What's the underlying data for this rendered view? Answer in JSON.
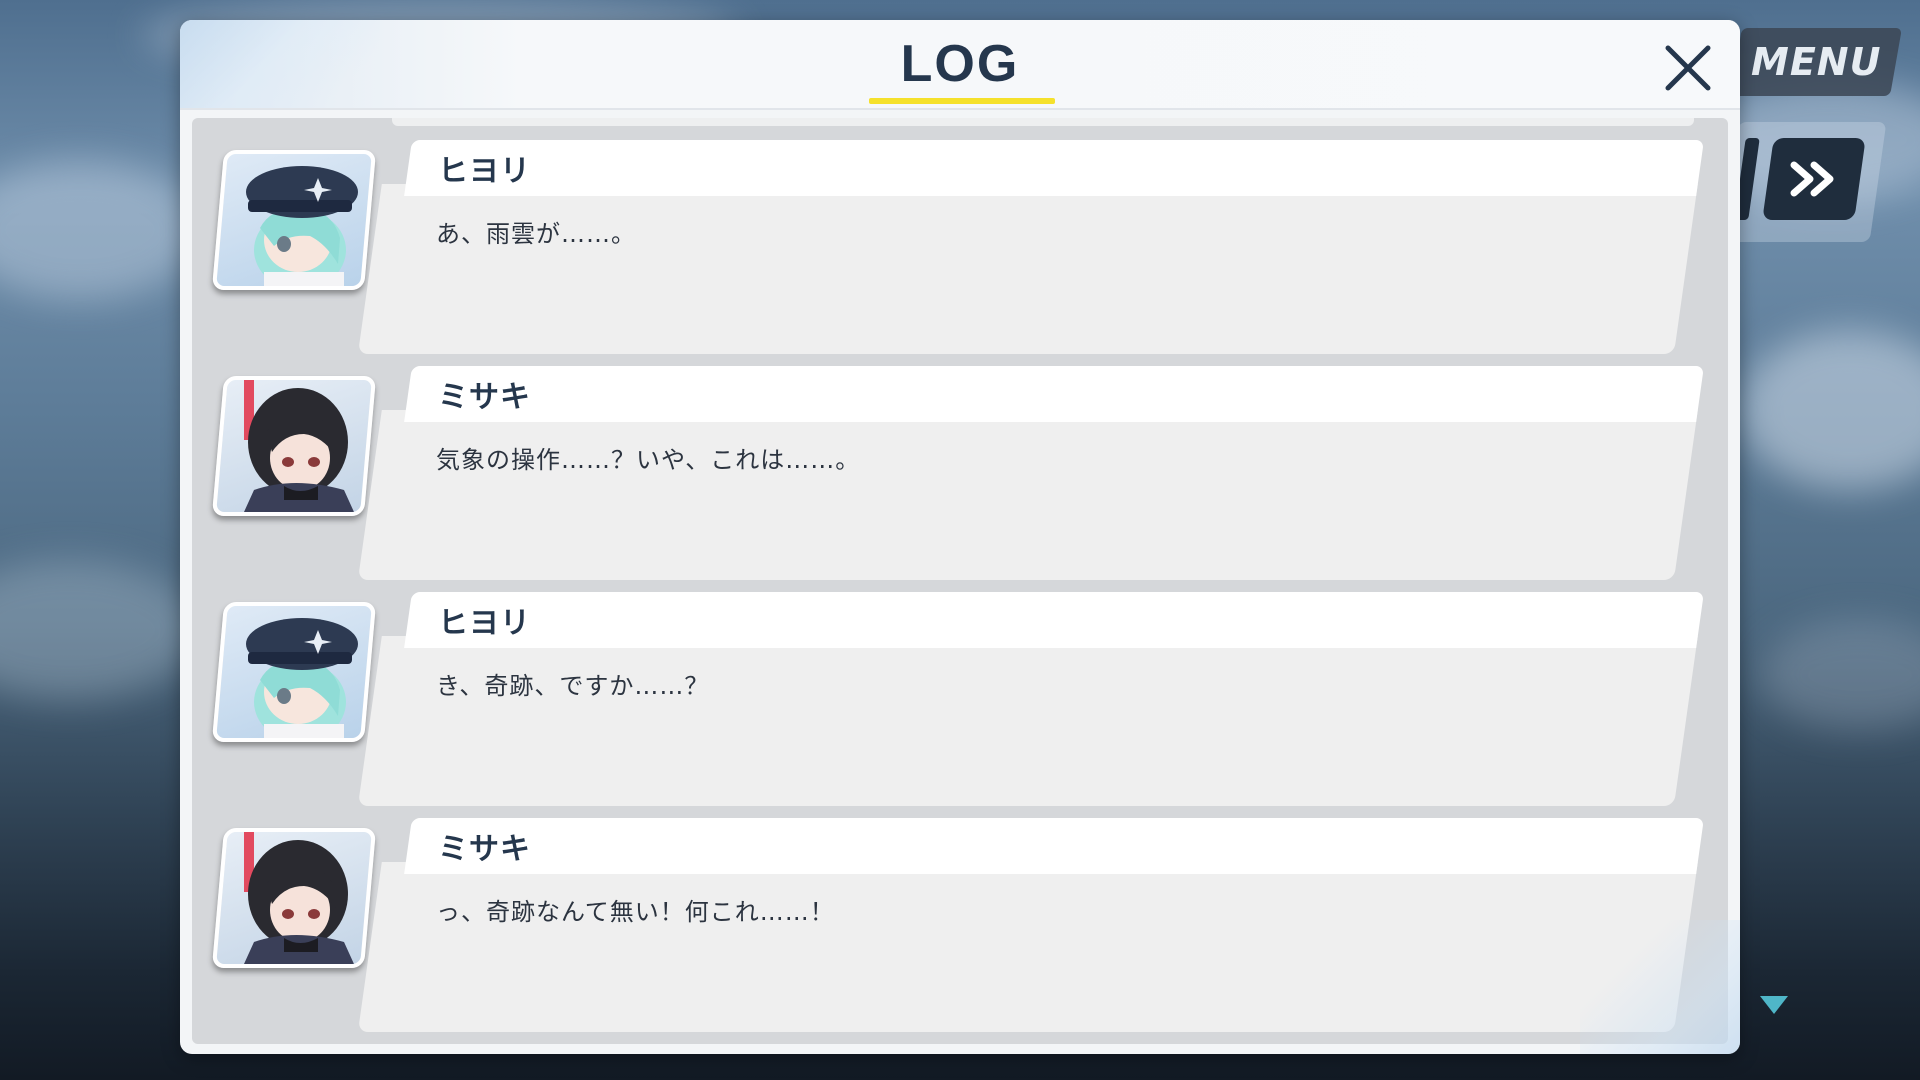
{
  "hud": {
    "menu_label": "MENU",
    "skip_icon": "fast-forward-icon",
    "auto_icon": "auto-play-icon"
  },
  "log": {
    "title": "LOG",
    "close_icon": "close-icon",
    "scroll_indicator_icon": "scroll-down-arrow-icon",
    "entries": [
      {
        "speaker": "ヒヨリ",
        "text": "あ、雨雲が……。",
        "portrait": "hiyori-portrait"
      },
      {
        "speaker": "ミサキ",
        "text": "気象の操作……？いや、これは……。",
        "portrait": "misaki-portrait"
      },
      {
        "speaker": "ヒヨリ",
        "text": "き、奇跡、ですか……？",
        "portrait": "hiyori-portrait"
      },
      {
        "speaker": "ミサキ",
        "text": "っ、奇跡なんて無い！何これ……！",
        "portrait": "misaki-portrait"
      }
    ]
  },
  "colors": {
    "title_text": "#25374d",
    "title_underline": "#f5e12c",
    "bubble_header": "#ffffff",
    "bubble_body": "#efefef",
    "log_body": "#d5d7da",
    "scroll_arrow": "#4fb6c8"
  }
}
